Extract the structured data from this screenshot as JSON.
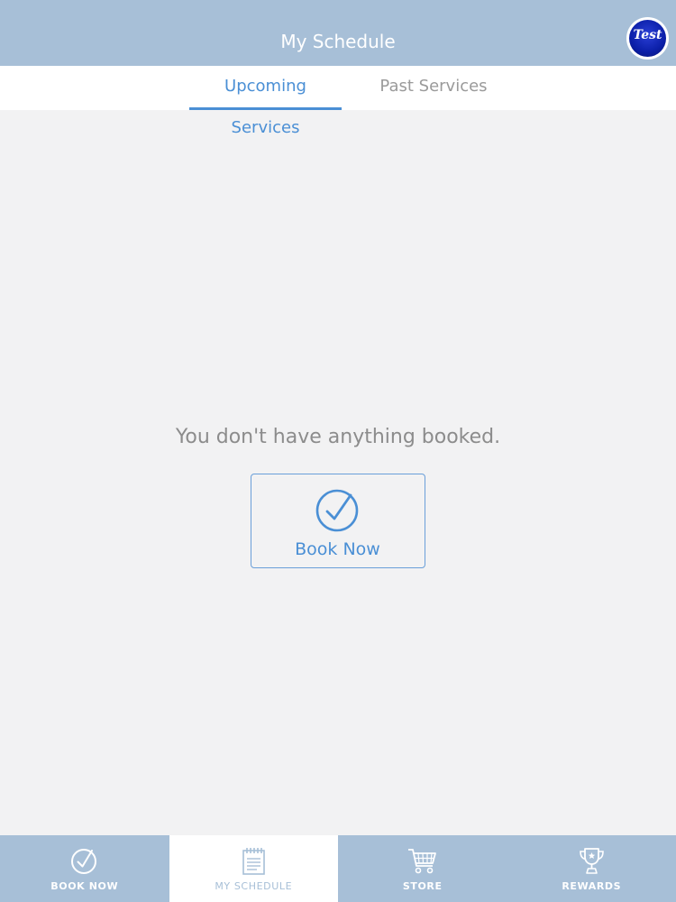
{
  "header": {
    "title": "My Schedule",
    "avatar_text": "Test"
  },
  "tabs": [
    {
      "label": "Upcoming Services",
      "active": true
    },
    {
      "label": "Past Services",
      "active": false
    }
  ],
  "empty_state": {
    "message": "You don't have anything booked.",
    "button_label": "Book Now",
    "button_icon": "check-circle-icon"
  },
  "bottom_nav": [
    {
      "label": "BOOK NOW",
      "icon": "check-circle-icon",
      "active": false
    },
    {
      "label": "MY SCHEDULE",
      "icon": "calendar-icon",
      "active": true
    },
    {
      "label": "STORE",
      "icon": "cart-icon",
      "active": false
    },
    {
      "label": "REWARDS",
      "icon": "trophy-icon",
      "active": false
    }
  ],
  "colors": {
    "header_bg": "#a7bfd7",
    "accent": "#4a8fd5",
    "background": "#f2f2f3",
    "muted_text": "#9a9a9a"
  }
}
